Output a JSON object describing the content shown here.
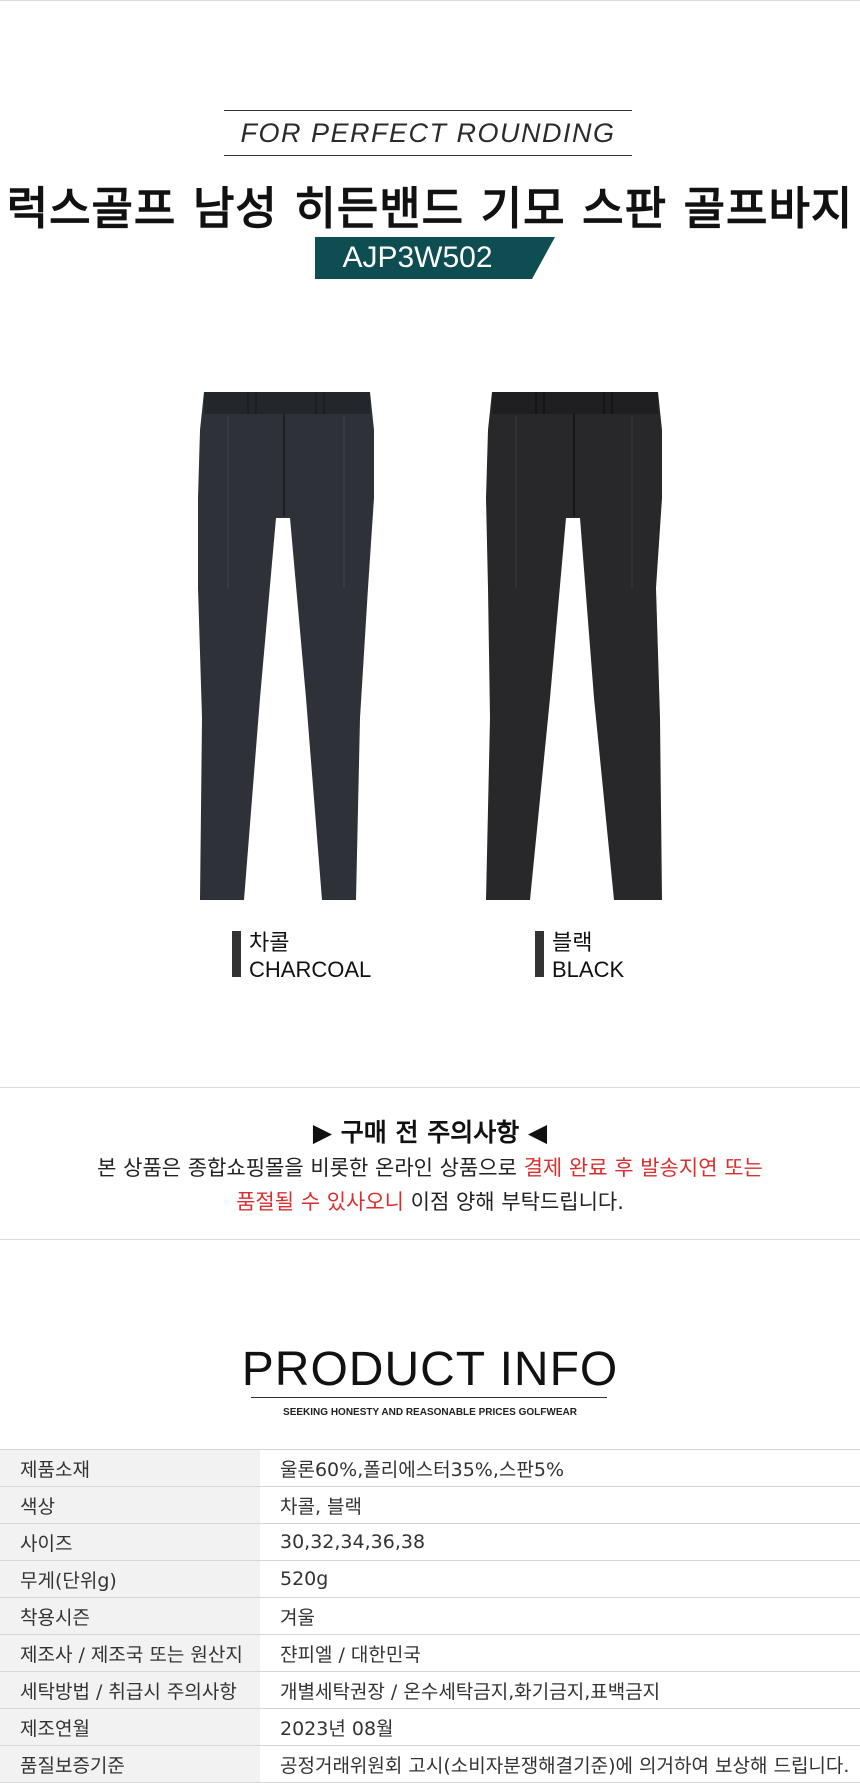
{
  "header": {
    "tagline": "FOR PERFECT ROUNDING",
    "title": "럭스골프 남성 히든밴드 기모 스판 골프바지",
    "product_code": "AJP3W502",
    "badge_color": "#0e4d52"
  },
  "colors": [
    {
      "name_ko": "차콜",
      "name_en": "CHARCOAL",
      "swatch": "#2e3238"
    },
    {
      "name_ko": "블랙",
      "name_en": "BLACK",
      "swatch": "#28272a"
    }
  ],
  "notice": {
    "title": "▶ 구매 전 주의사항 ◀",
    "line1_normal": "본 상품은 종합쇼핑몰을 비롯한 온라인 상품으로 ",
    "line1_red": "결제 완료 후 발송지연 또는",
    "line2_red": "품절될 수 있사오니",
    "line2_normal": " 이점 양해 부탁드립니다."
  },
  "product_info": {
    "title": "PRODUCT INFO",
    "subtitle": "SEEKING HONESTY AND REASONABLE PRICES GOLFWEAR",
    "rows": [
      {
        "label": "제품소재",
        "value": "울론60%,폴리에스터35%,스판5%"
      },
      {
        "label": "색상",
        "value": "차콜, 블랙"
      },
      {
        "label": "사이즈",
        "value": "30,32,34,36,38"
      },
      {
        "label": "무게(단위g)",
        "value": "520g"
      },
      {
        "label": "착용시즌",
        "value": "겨울"
      },
      {
        "label": "제조사 / 제조국 또는 원산지",
        "value": "쟌피엘 / 대한민국"
      },
      {
        "label": "세탁방법 / 취급시 주의사항",
        "value": "개별세탁권장 / 온수세탁금지,화기금지,표백금지"
      },
      {
        "label": "제조연월",
        "value": "2023년 08월"
      },
      {
        "label": "품질보증기준",
        "value": "공정거래위원회 고시(소비자분쟁해결기준)에 의거하여  보상해 드립니다."
      }
    ]
  }
}
